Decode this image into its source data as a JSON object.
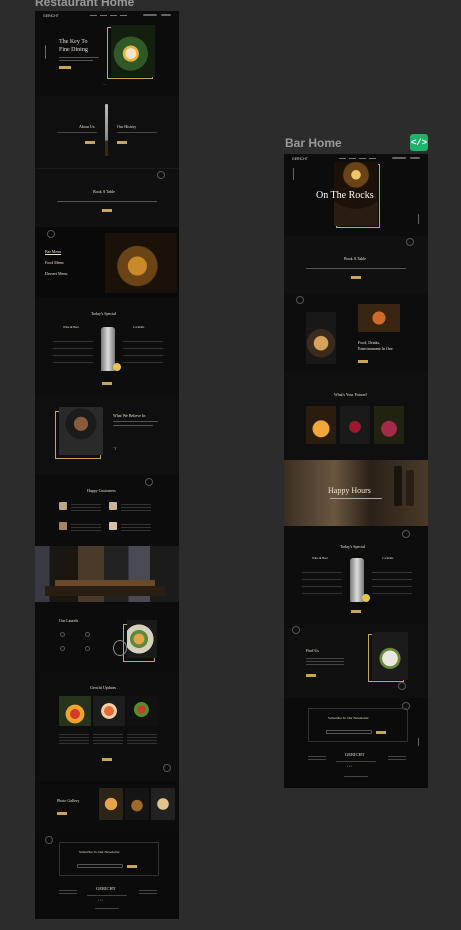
{
  "canvas": {
    "frames": [
      {
        "label": "Restaurant Home"
      },
      {
        "label": "Bar Home"
      }
    ],
    "code_badge": "</>"
  },
  "restaurant": {
    "nav_logo": "GERICHT",
    "hero_title_1": "The Key To",
    "hero_title_2": "Fine Dining",
    "about_title": "About Us",
    "history_title": "Our History",
    "book_title": "Book A Table",
    "menu_items": [
      "Bar Menu",
      "Food Menu",
      "Dessert Menu"
    ],
    "special_title": "Today's Special",
    "wine_title": "Wine & Beer",
    "cocktails_title": "Cocktails",
    "believe_title": "What We Believe In",
    "customers_title": "Happy Customers",
    "awards_title": "Our Laurels",
    "updates_title": "Gericht Updates",
    "gallery_title": "Photo Gallery",
    "newsletter_title": "Subscribe To Our Newsletter",
    "footer_logo": "GERICHT"
  },
  "bar": {
    "nav_logo": "GERICHT",
    "hero_title": "On The Rocks",
    "book_title": "Book A Table",
    "food_title_1": "Food, Drinks,",
    "food_title_2": "Entertainment In One",
    "passion_title": "What's Your Poison?",
    "happy_hours_title": "Happy Hours",
    "special_title": "Today's Special",
    "wine_title": "Wine & Beer",
    "cocktails_title": "Cocktails",
    "find_title": "Find Us",
    "newsletter_title": "Subscribe To Our Newsletter",
    "footer_logo": "GERICHT"
  }
}
